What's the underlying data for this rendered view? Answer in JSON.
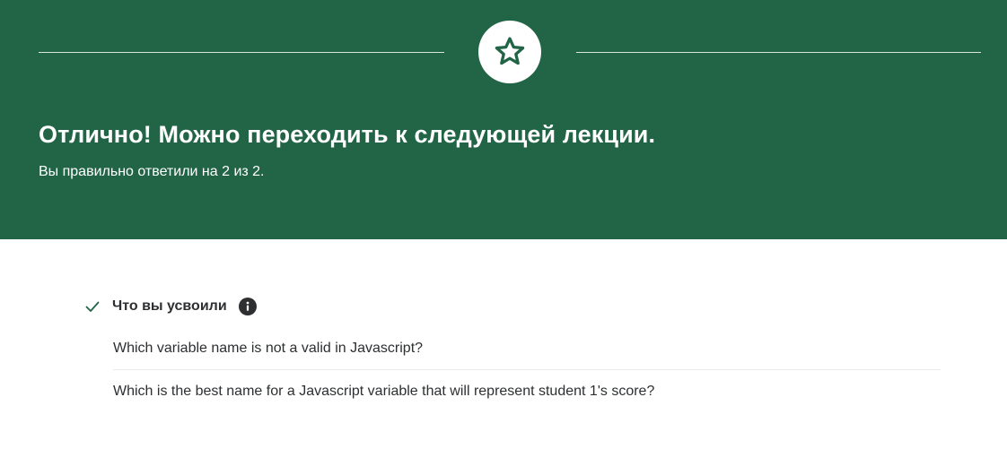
{
  "result": {
    "headline": "Отлично! Можно переходить к следующей лекции.",
    "score_text": "Вы правильно ответили на 2 из 2.",
    "icon": "star-icon"
  },
  "learned": {
    "title": "Что вы усвоили",
    "status_icon": "check-icon",
    "info_icon": "info-icon",
    "questions": [
      "Which variable name is not a valid in Javascript?",
      "Which is the best name for a Javascript variable that will represent student 1's score?"
    ]
  },
  "colors": {
    "banner": "#226546",
    "text_dark": "#2d2f31",
    "accent_green": "#226546"
  }
}
